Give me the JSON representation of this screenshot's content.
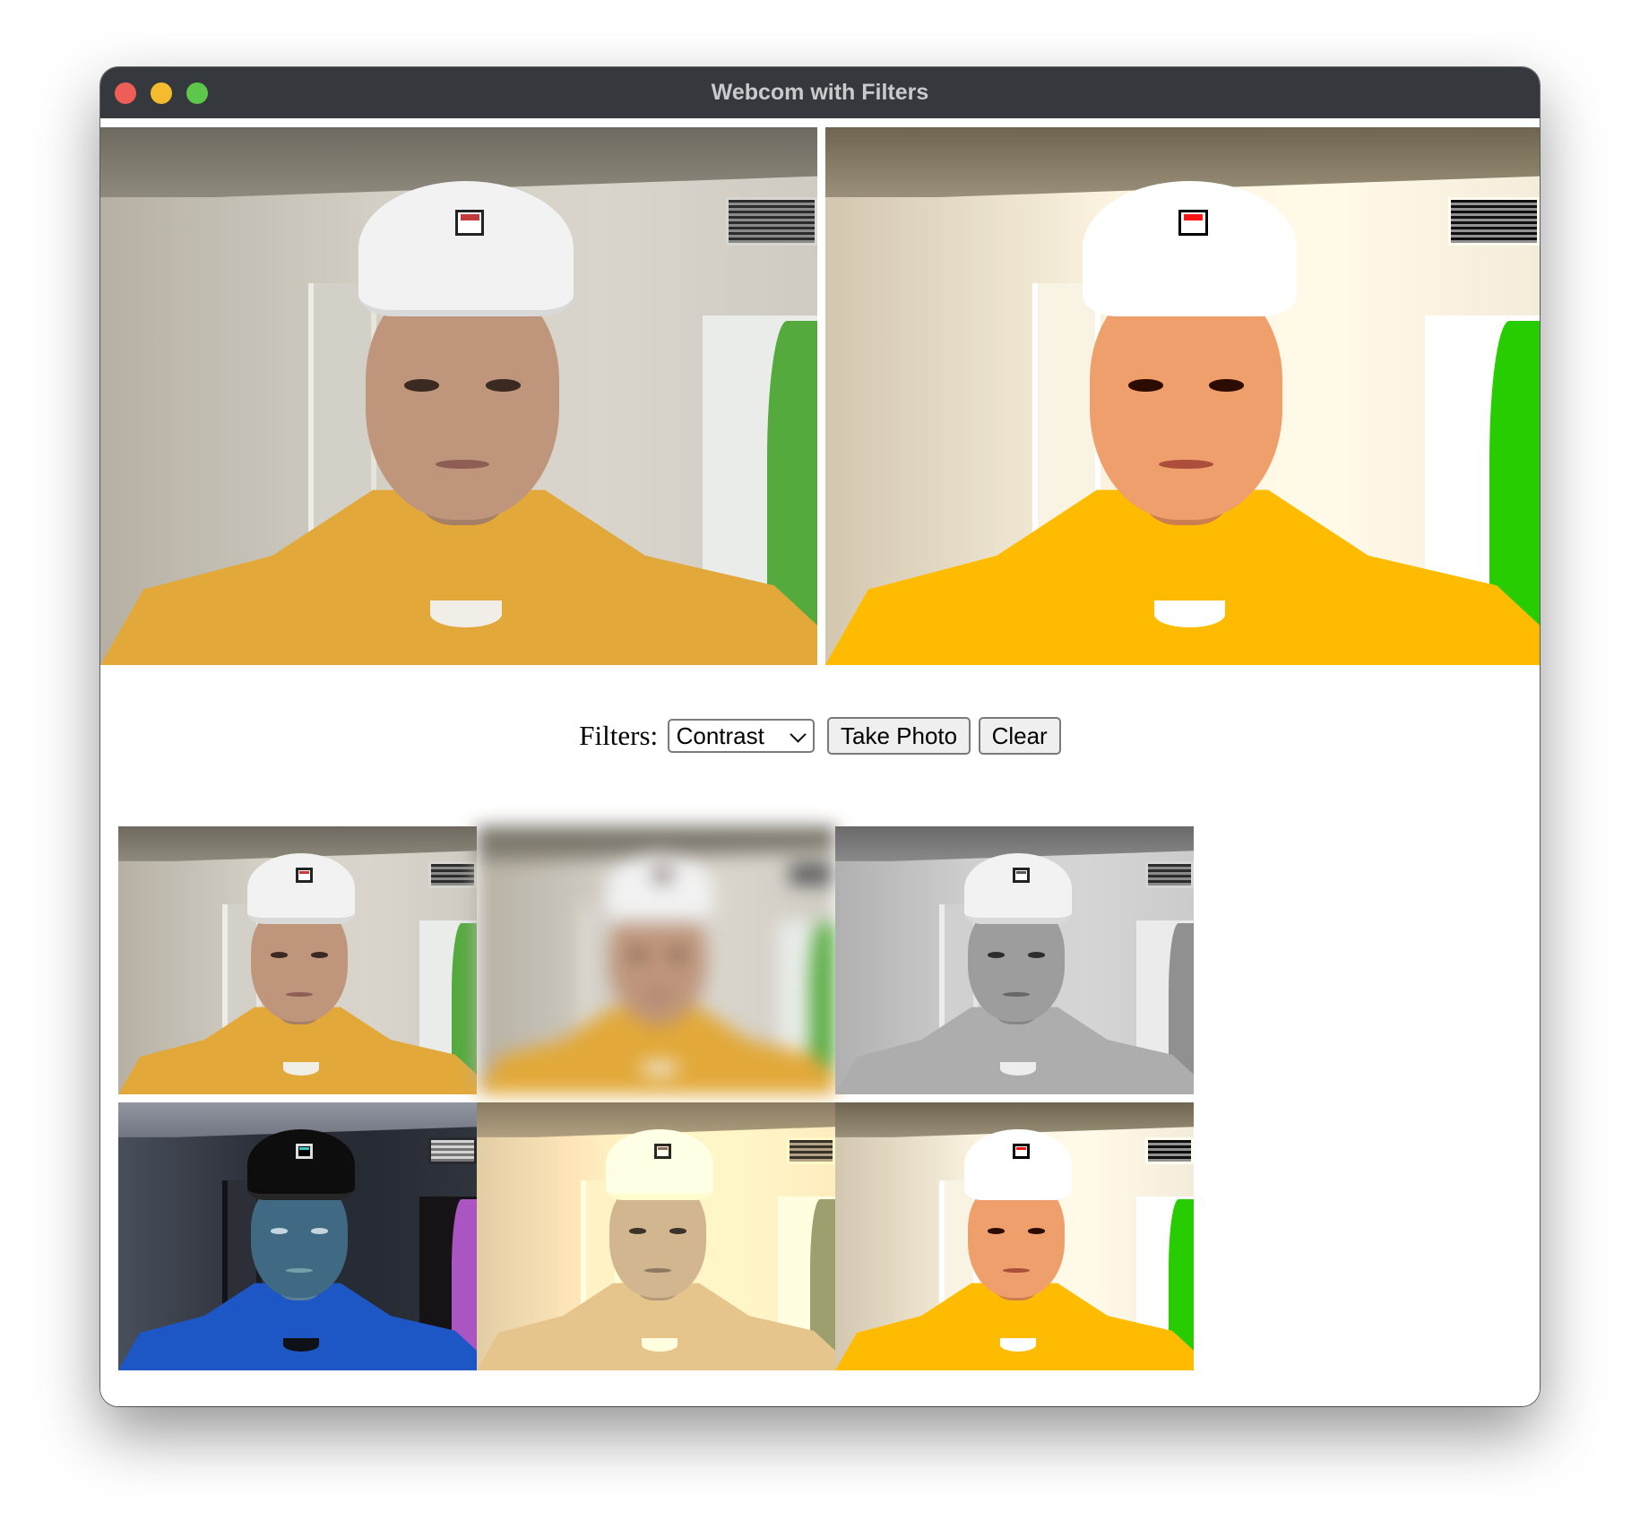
{
  "window": {
    "title": "Webcom with Filters",
    "traffic_lights": [
      "close",
      "minimize",
      "maximize"
    ]
  },
  "feeds": {
    "live": {
      "filter": "none"
    },
    "filtered": {
      "filter": "contrast"
    }
  },
  "controls": {
    "filters_label": "Filters:",
    "selected_filter": "Contrast",
    "take_photo_label": "Take Photo",
    "clear_label": "Clear"
  },
  "gallery": {
    "photos": [
      {
        "filter": "none"
      },
      {
        "filter": "blur"
      },
      {
        "filter": "grayscale"
      },
      {
        "filter": "invert"
      },
      {
        "filter": "sepia"
      },
      {
        "filter": "contrast"
      }
    ]
  },
  "colors": {
    "titlebar": "#35383c",
    "close": "#ee5e57",
    "minimize": "#f4bb2f",
    "maximize": "#5cc74b",
    "hoodie": "#e2a93a"
  }
}
